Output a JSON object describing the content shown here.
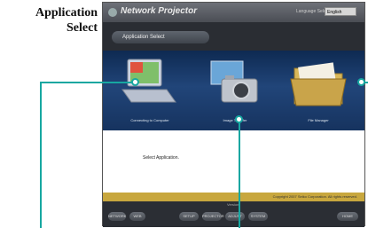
{
  "doc": {
    "heading_line1": "Application",
    "heading_line2": "Select"
  },
  "window": {
    "title": "Network Projector",
    "language_label": "Language Select",
    "language_value": "English",
    "tab_label": "Application Select",
    "apps": [
      {
        "icon": "laptop-icon",
        "caption": "Connecting to Computer"
      },
      {
        "icon": "camera-icon",
        "caption": "Image Transfer"
      },
      {
        "icon": "folder-icon",
        "caption": "File Manager"
      }
    ],
    "prompt": "Select Application.",
    "copyright": "Copyright 2007 Seiko Corporation. All rights reserved.",
    "version": "Version",
    "buttons": [
      "NETWORK",
      "WEB",
      "SETUP",
      "PROJECTOR",
      "ADJUST",
      "SYSTEM",
      "HOME"
    ]
  },
  "colors": {
    "callout": "#17a7a1",
    "band": "#214579",
    "gold": "#c8a73e"
  }
}
